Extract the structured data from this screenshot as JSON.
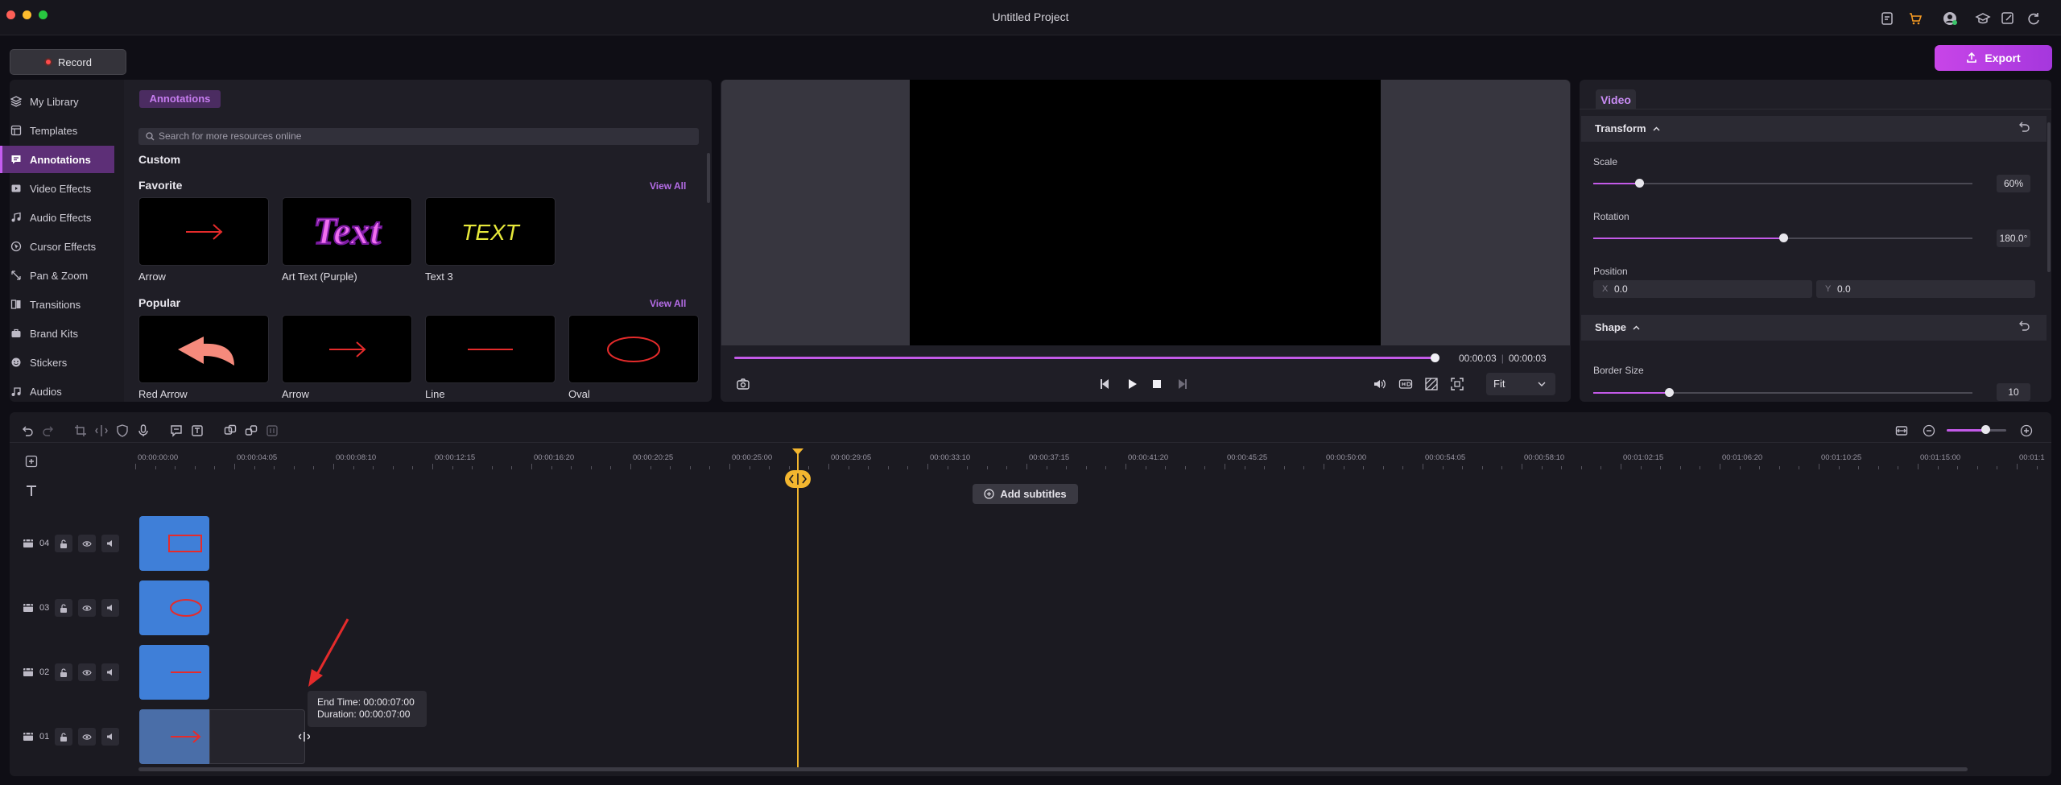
{
  "window": {
    "title": "Untitled Project"
  },
  "toolbar": {
    "record_label": "Record",
    "export_label": "Export"
  },
  "sidebar": {
    "items": [
      {
        "label": "My Library",
        "icon": "layers-icon"
      },
      {
        "label": "Templates",
        "icon": "template-icon"
      },
      {
        "label": "Annotations",
        "icon": "annotation-icon",
        "active": true
      },
      {
        "label": "Video Effects",
        "icon": "video-effects-icon"
      },
      {
        "label": "Audio Effects",
        "icon": "music-note-icon"
      },
      {
        "label": "Cursor Effects",
        "icon": "cursor-icon"
      },
      {
        "label": "Pan & Zoom",
        "icon": "pan-zoom-icon"
      },
      {
        "label": "Transitions",
        "icon": "transitions-icon"
      },
      {
        "label": "Brand Kits",
        "icon": "brand-kit-icon"
      },
      {
        "label": "Stickers",
        "icon": "sticker-icon"
      },
      {
        "label": "Audios",
        "icon": "music-icon"
      }
    ]
  },
  "library": {
    "tab": "Annotations",
    "search_placeholder": "Search for more resources online",
    "custom_title": "Custom",
    "favorite": {
      "title": "Favorite",
      "view_all": "View All",
      "items": [
        "Arrow",
        "Art Text (Purple)",
        "Text 3"
      ],
      "art_text": "Text",
      "text3_text": "TEXT"
    },
    "popular": {
      "title": "Popular",
      "view_all": "View All",
      "items": [
        "Red Arrow",
        "Arrow",
        "Line",
        "Oval"
      ]
    }
  },
  "preview": {
    "current_time": "00:00:03",
    "total_time": "00:00:03",
    "progress": 1.0,
    "fit": "Fit"
  },
  "properties": {
    "tab": "Video",
    "transform_title": "Transform",
    "scale_label": "Scale",
    "scale_value": "60%",
    "scale_fraction": 0.12,
    "rotation_label": "Rotation",
    "rotation_value": "180.0°",
    "rotation_fraction": 0.5,
    "position_label": "Position",
    "pos_x_axis": "X",
    "pos_x": "0.0",
    "pos_y_axis": "Y",
    "pos_y": "0.0",
    "shape_title": "Shape",
    "border_label": "Border Size",
    "border_value": "10",
    "border_fraction": 0.2
  },
  "timeline": {
    "ruler": [
      "00:00:00:00",
      "00:00:04:05",
      "00:00:08:10",
      "00:00:12:15",
      "00:00:16:20",
      "00:00:20:25",
      "00:00:25:00",
      "00:00:29:05",
      "00:00:33:10",
      "00:00:37:15",
      "00:00:41:20",
      "00:00:45:25",
      "00:00:50:00",
      "00:00:54:05",
      "00:00:58:10",
      "00:01:02:15",
      "00:01:06:20",
      "00:01:10:25",
      "00:01:15:00",
      "00:01:1"
    ],
    "add_subtitles": "Add subtitles",
    "tracks": [
      "04",
      "03",
      "02",
      "01"
    ],
    "tooltip_end": "End Time: 00:00:07:00",
    "tooltip_duration": "Duration: 00:00:07:00",
    "zoom_level": 0.68
  },
  "colors": {
    "accent": "#c35ae8",
    "playhead": "#f3b62f",
    "clip": "#3f7fd8",
    "annotation_red": "#e52b2b"
  }
}
